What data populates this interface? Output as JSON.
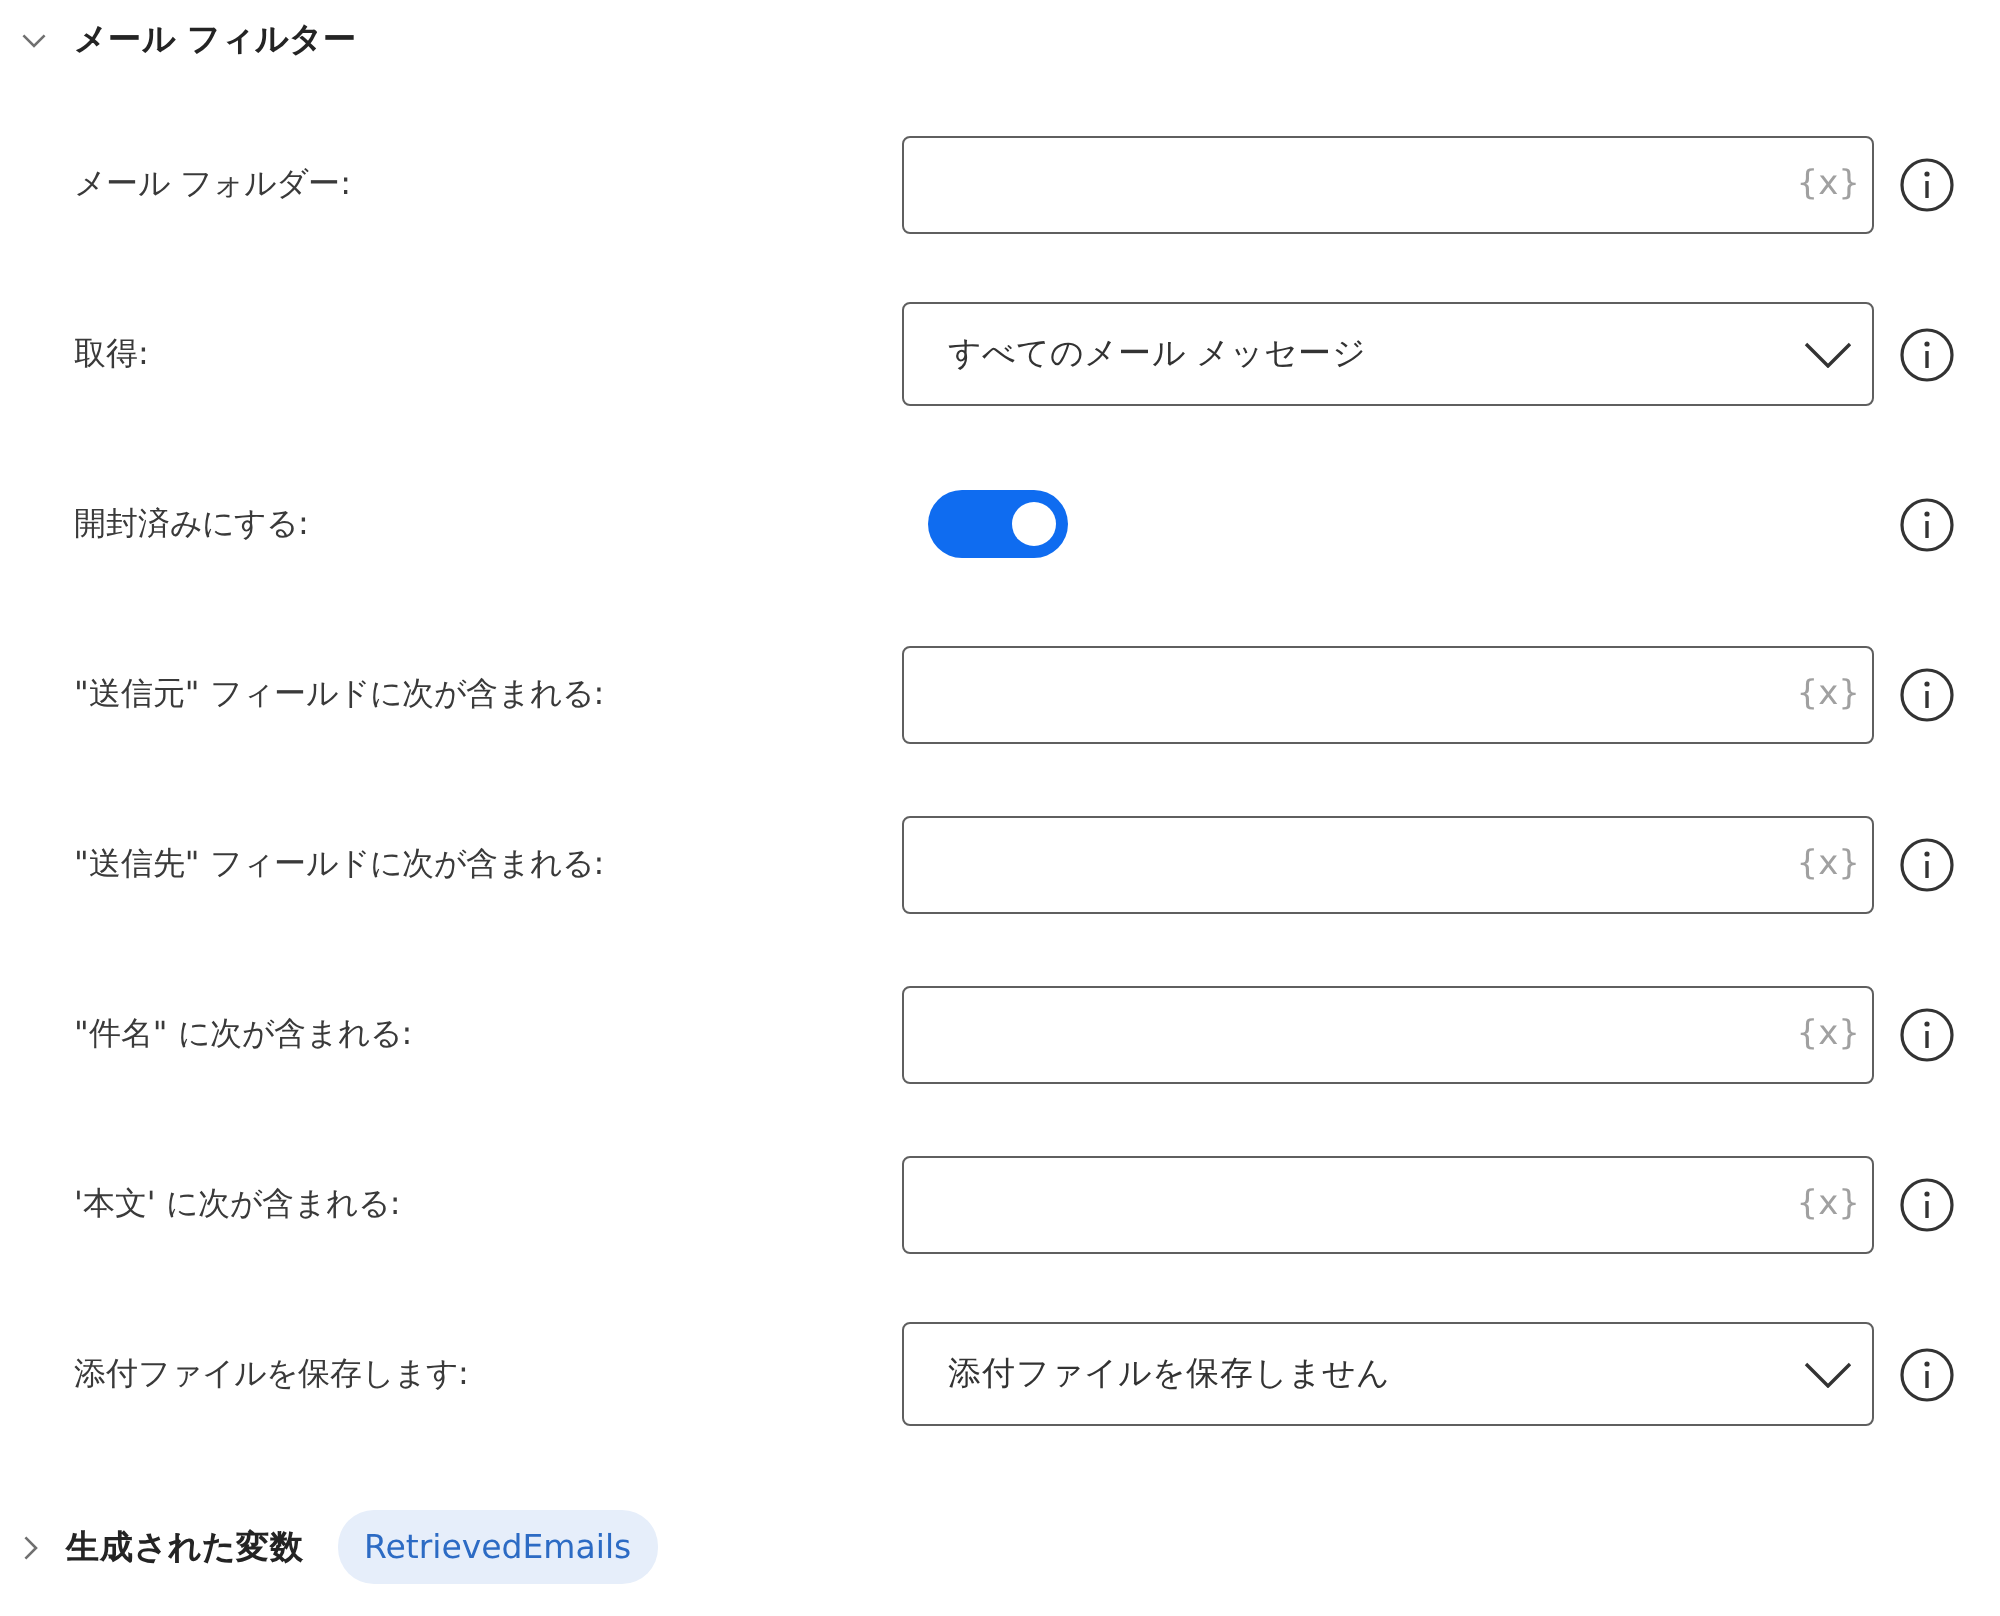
{
  "section": {
    "title": "メール フィルター",
    "expanded": true
  },
  "fields": [
    {
      "kind": "text",
      "label": "メール フォルダー:",
      "variable_button": "{x}"
    },
    {
      "kind": "select",
      "label": "取得:",
      "value": "すべてのメール メッセージ"
    },
    {
      "kind": "toggle",
      "label": "開封済みにする:",
      "on": true
    },
    {
      "kind": "text",
      "label": "\"送信元\" フィールドに次が含まれる:",
      "variable_button": "{x}"
    },
    {
      "kind": "text",
      "label": "\"送信先\" フィールドに次が含まれる:",
      "variable_button": "{x}"
    },
    {
      "kind": "text",
      "label": "\"件名\" に次が含まれる:",
      "variable_button": "{x}"
    },
    {
      "kind": "text",
      "label": "'本文' に次が含まれる:",
      "variable_button": "{x}"
    },
    {
      "kind": "select",
      "label": "添付ファイルを保存します:",
      "value": "添付ファイルを保存しません"
    }
  ],
  "generated_variables": {
    "title": "生成された変数",
    "expanded": false,
    "variables": [
      "RetrievedEmails"
    ]
  }
}
